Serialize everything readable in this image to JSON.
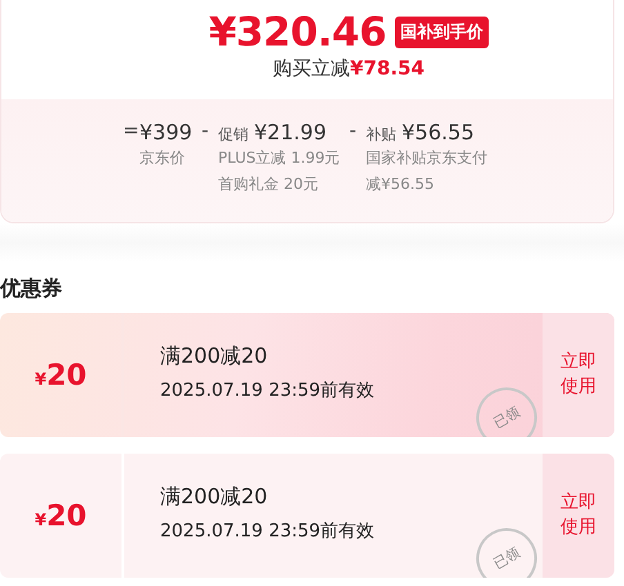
{
  "summary": {
    "price": "¥320.46",
    "price_tag": "国补到手价",
    "saving_label": "购买立减",
    "saving_amount": "¥78.54",
    "breakdown": [
      {
        "op": "=",
        "amount": "¥399",
        "notes": [
          "京东价"
        ]
      },
      {
        "op": "-",
        "label": "促销",
        "amount": "¥21.99",
        "notes": [
          "PLUS立减 1.99元",
          "首购礼金 20元"
        ]
      },
      {
        "op": "-",
        "label": "补贴",
        "amount": "¥56.55",
        "notes": [
          "国家补贴京东支付",
          "减¥56.55"
        ]
      }
    ]
  },
  "coupons_section": {
    "title": "优惠券",
    "coupons": [
      {
        "value_symbol": "¥",
        "value": "20",
        "rule": "满200减20",
        "validity": "2025.07.19 23:59前有效",
        "stamp": "已领",
        "action": "立即使用",
        "featured": true
      },
      {
        "value_symbol": "¥",
        "value": "20",
        "rule": "满200减20",
        "validity": "2025.07.19 23:59前有效",
        "stamp": "已领",
        "action": "立即使用",
        "featured": false
      }
    ]
  }
}
